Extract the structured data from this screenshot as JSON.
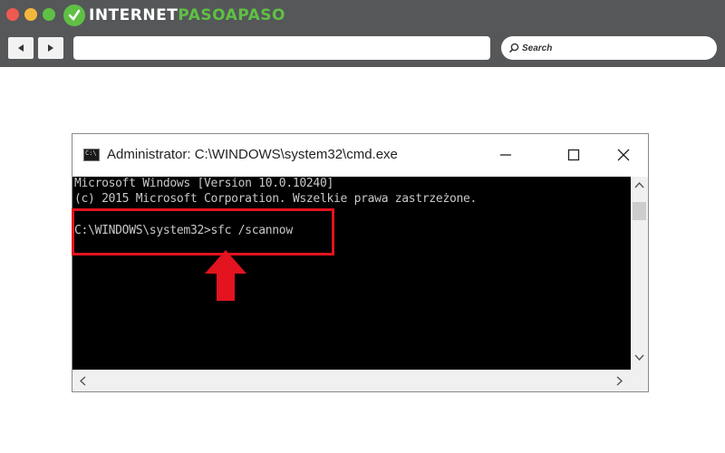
{
  "browser": {
    "logo_part1": "INTERNET",
    "logo_part2": "PASOAPASO",
    "search_placeholder": "Search",
    "url_value": ""
  },
  "cmd_window": {
    "title": "Administrator: C:\\WINDOWS\\system32\\cmd.exe",
    "icon_label": "C:\\",
    "lines": [
      "Microsoft Windows [Version 10.0.10240]",
      "(c) 2015 Microsoft Corporation. Wszelkie prawa zastrzeżone.",
      "C:\\WINDOWS\\system32>sfc /scannow"
    ]
  },
  "colors": {
    "chrome_bg": "#555759",
    "console_bg": "#000000",
    "console_text": "#c8c8c8",
    "highlight": "#e3131f",
    "brand_green": "#5fc045"
  }
}
